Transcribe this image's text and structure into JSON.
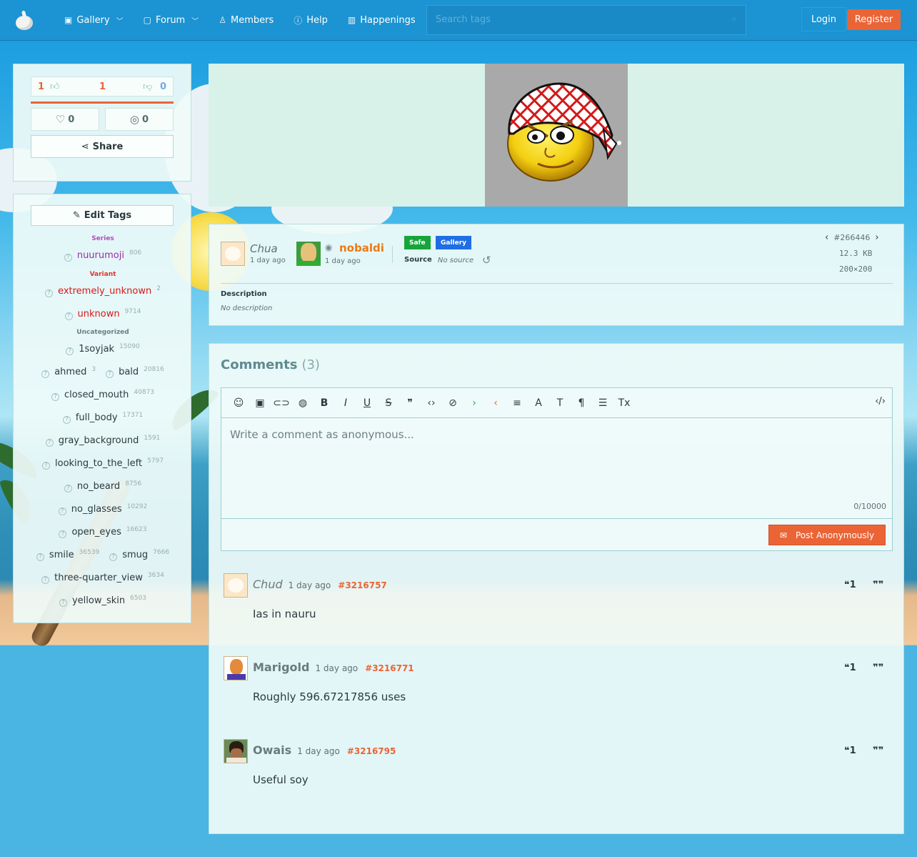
{
  "nav": {
    "items": [
      {
        "label": "Gallery",
        "icon": "image-icon",
        "dropdown": true
      },
      {
        "label": "Forum",
        "icon": "chat-icon",
        "dropdown": true
      },
      {
        "label": "Members",
        "icon": "user-icon",
        "dropdown": false
      },
      {
        "label": "Help",
        "icon": "help-icon",
        "dropdown": false
      },
      {
        "label": "Happenings",
        "icon": "book-icon",
        "dropdown": false
      }
    ],
    "search_placeholder": "Search tags",
    "login": "Login",
    "register": "Register"
  },
  "votes": {
    "up": "1",
    "score": "1",
    "down": "0",
    "favorites": "0",
    "hides": "0",
    "share": "Share"
  },
  "tags": {
    "edit_label": "Edit Tags",
    "categories": [
      {
        "name": "Series",
        "color": "#b04fb8"
      },
      {
        "name": "Variant",
        "color": "#e0342c"
      },
      {
        "name": "Uncategorized",
        "color": "#6b7f82"
      }
    ],
    "items": [
      {
        "name": "nuurumoji",
        "count": "806",
        "color": "#a02aa8"
      },
      {
        "name": "extremely_unknown",
        "count": "2",
        "color": "#d81818"
      },
      {
        "name": "unknown",
        "count": "9714",
        "color": "#d81818"
      },
      {
        "name": "1soyjak",
        "count": "15090"
      },
      {
        "name": "ahmed",
        "count": "3"
      },
      {
        "name": "bald",
        "count": "20816"
      },
      {
        "name": "closed_mouth",
        "count": "40873"
      },
      {
        "name": "full_body",
        "count": "17371"
      },
      {
        "name": "gray_background",
        "count": "1591"
      },
      {
        "name": "looking_to_the_left",
        "count": "5797"
      },
      {
        "name": "no_beard",
        "count": "8756"
      },
      {
        "name": "no_glasses",
        "count": "10292"
      },
      {
        "name": "open_eyes",
        "count": "16623"
      },
      {
        "name": "smile",
        "count": "36539"
      },
      {
        "name": "smug",
        "count": "7666"
      },
      {
        "name": "three-quarter_view",
        "count": "3634"
      },
      {
        "name": "yellow_skin",
        "count": "6503"
      }
    ]
  },
  "post": {
    "uploader": "Chua",
    "uploader_time": "1 day ago",
    "owner": "nobaldi",
    "owner_time": "1 day ago",
    "rating": "Safe",
    "category": "Gallery",
    "source_label": "Source",
    "source": "No source",
    "id": "#266446",
    "file_size": "12.3 KB",
    "dimensions": "200×200",
    "description_label": "Description",
    "description": "No description"
  },
  "comments": {
    "title": "Comments",
    "count": "(3)",
    "placeholder": "Write a comment as anonymous...",
    "char_count": "0/10000",
    "post_button": "Post Anonymously",
    "list": [
      {
        "author": "Chud",
        "time": "1 day ago",
        "id": "#3216757",
        "body": "Ias in nauru"
      },
      {
        "author": "Marigold",
        "time": "1 day ago",
        "id": "#3216771",
        "body": "Roughly 596.67217856 uses"
      },
      {
        "author": "Owais",
        "time": "1 day ago",
        "id": "#3216795",
        "body": "Useful soy"
      }
    ]
  },
  "colors": {
    "accent": "#ea6436",
    "nav_bg": "#1c93d2",
    "safe": "#17a53b",
    "gallery": "#1f6ee6"
  }
}
